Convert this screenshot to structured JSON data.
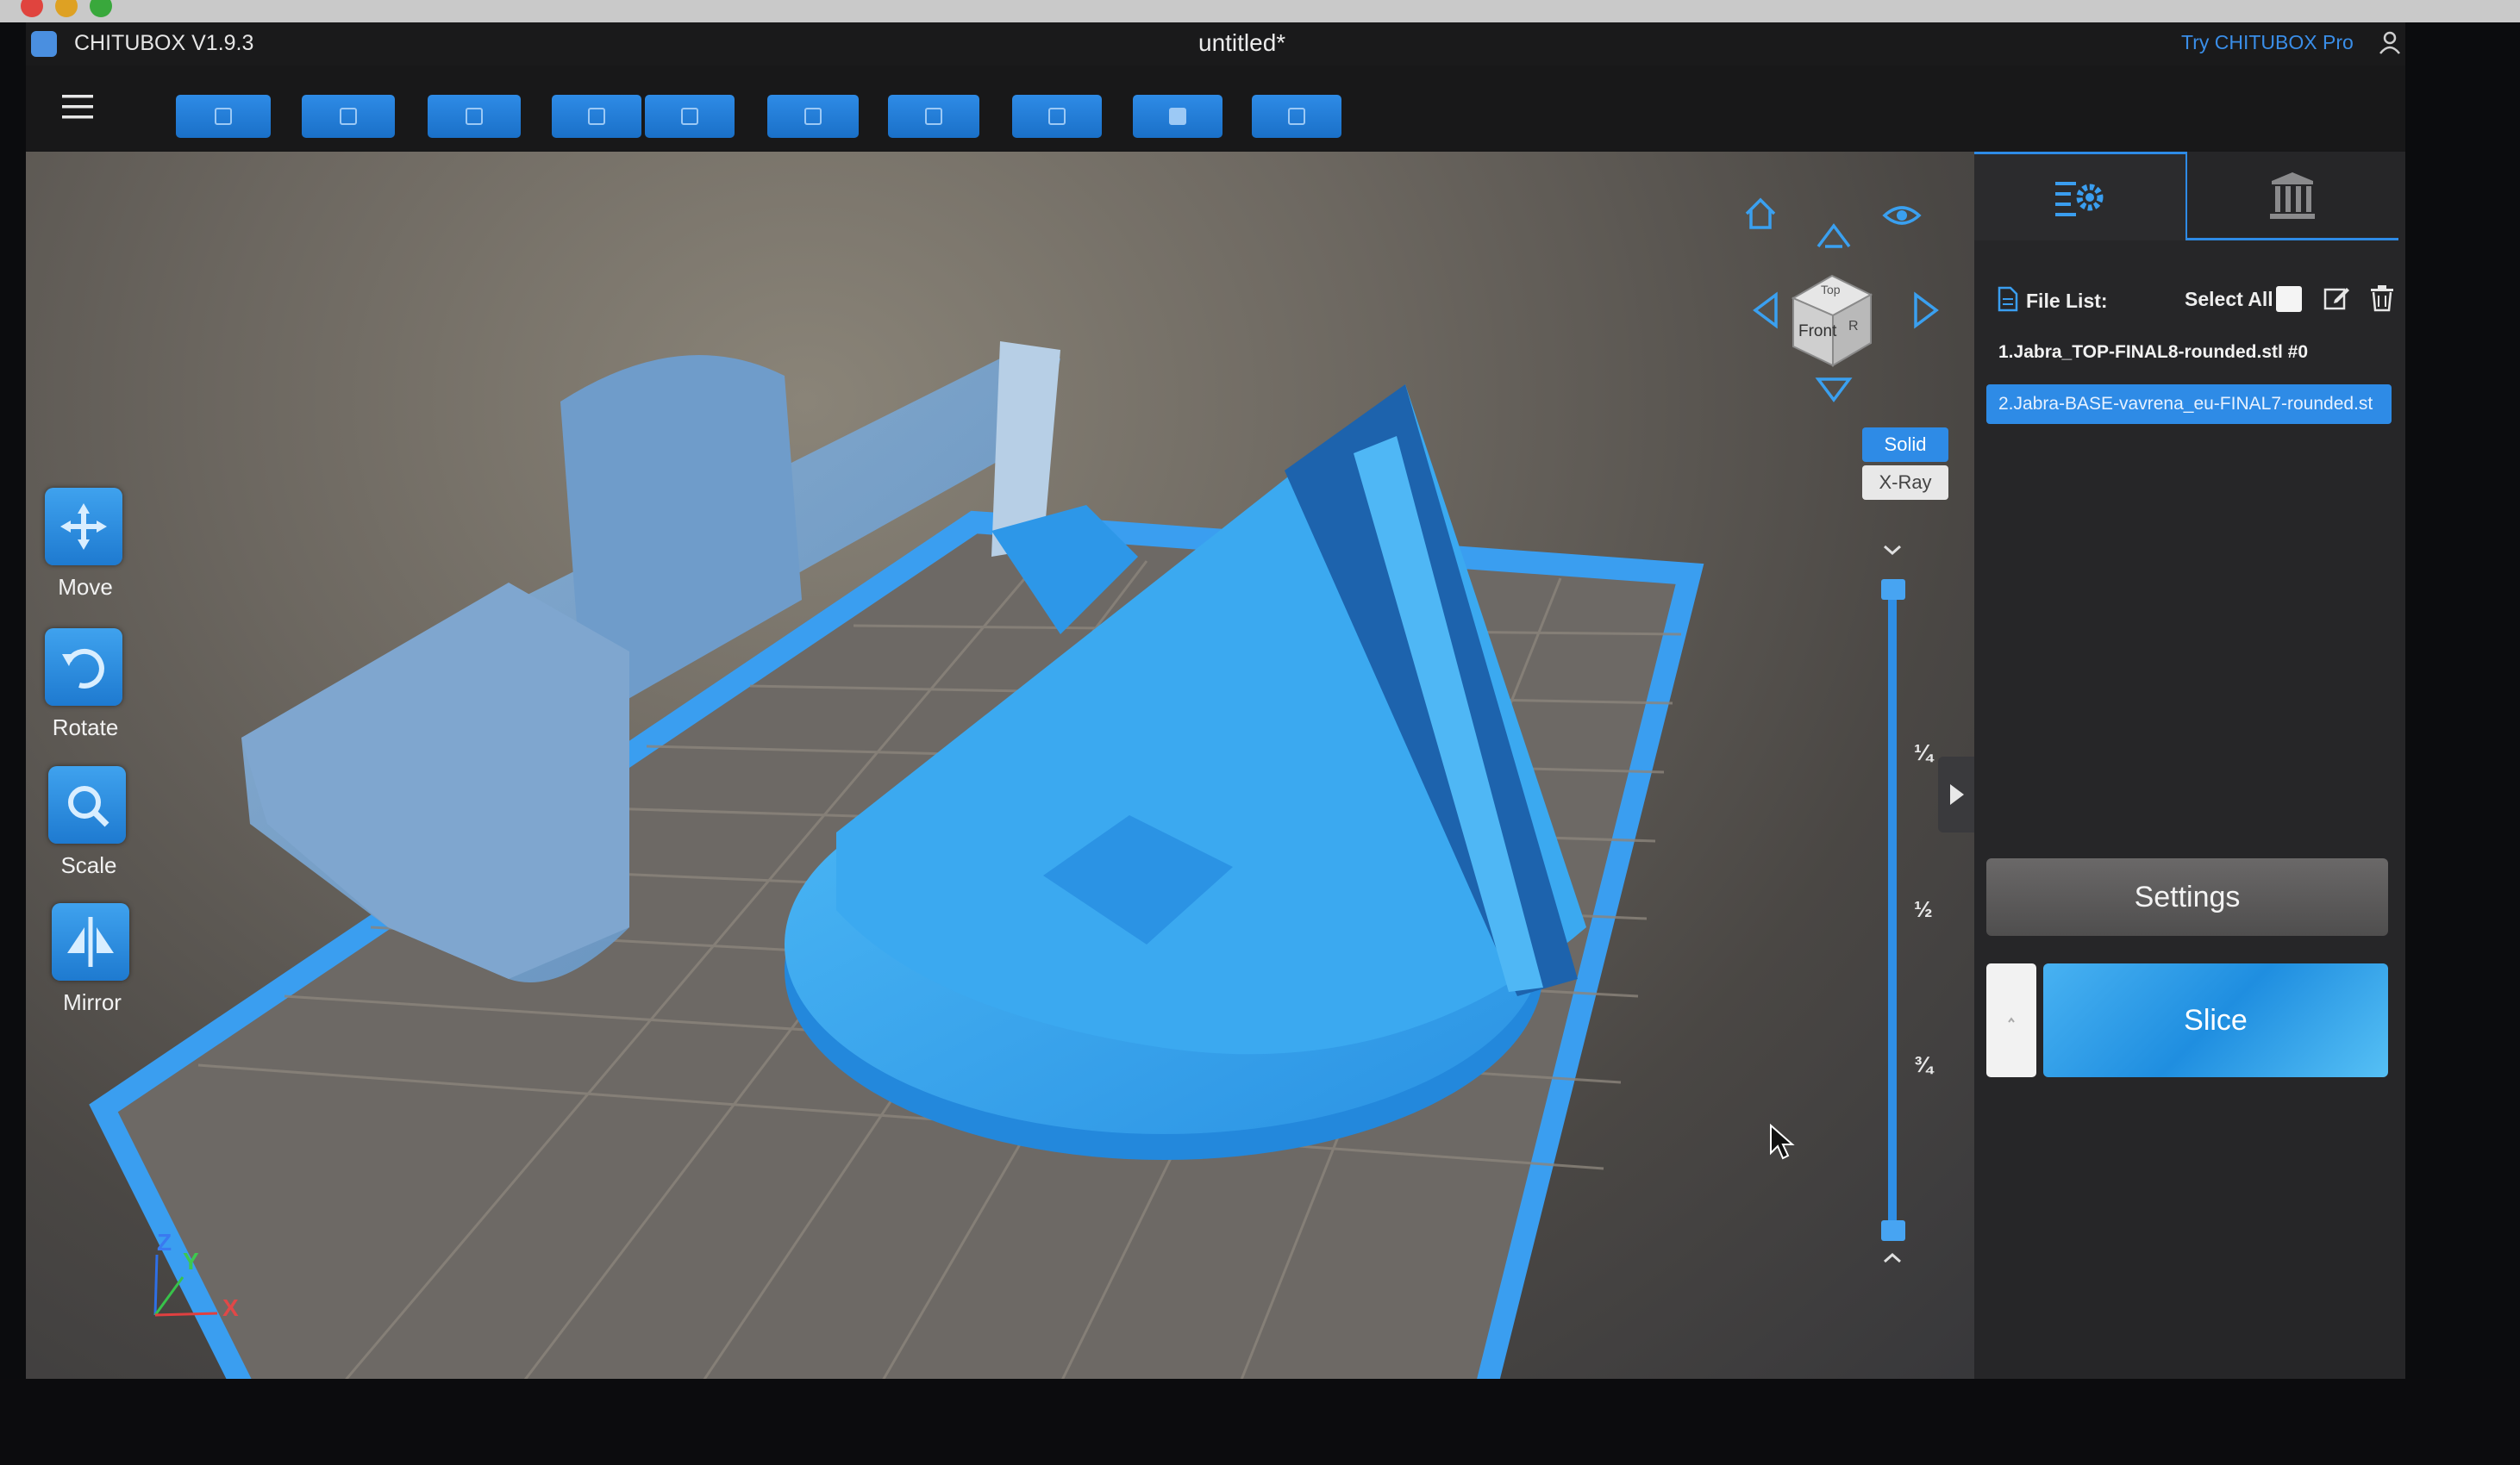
{
  "window": {
    "app_name": "CHITUBOX V1.9.3",
    "document_title": "untitled*",
    "try_pro_link": "Try CHITUBOX Pro"
  },
  "toolbar": {
    "buttons": [
      "open-file-icon",
      "save-icon",
      "auto-layout-icon",
      "undo-icon",
      "redo-icon",
      "copy-icon",
      "cut-icon",
      "support-icon",
      "hollow-icon",
      "dig-hole-icon"
    ]
  },
  "tools": [
    {
      "label": "Move",
      "icon": "move-icon"
    },
    {
      "label": "Rotate",
      "icon": "rotate-icon"
    },
    {
      "label": "Scale",
      "icon": "scale-icon"
    },
    {
      "label": "Mirror",
      "icon": "mirror-icon"
    }
  ],
  "view": {
    "cube_faces": {
      "top": "Top",
      "front": "Front",
      "right": "R"
    },
    "solid_label": "Solid",
    "xray_label": "X-Ray",
    "slider_marks": [
      "¼",
      "½",
      "¾"
    ],
    "axes": {
      "z": "Z",
      "y": "Y",
      "x": "X"
    }
  },
  "panel": {
    "file_list_label": "File List:",
    "select_all_label": "Select All",
    "files": [
      "1.Jabra_TOP-FINAL8-rounded.stl #0",
      "2.Jabra-BASE-vavrena_eu-FINAL7-rounded.st"
    ],
    "selected_index": 1,
    "settings_label": "Settings",
    "slice_label": "Slice"
  },
  "colors": {
    "accent": "#2e8be6",
    "model": "#35a8f0",
    "model_dark": "#1c5ea6"
  }
}
